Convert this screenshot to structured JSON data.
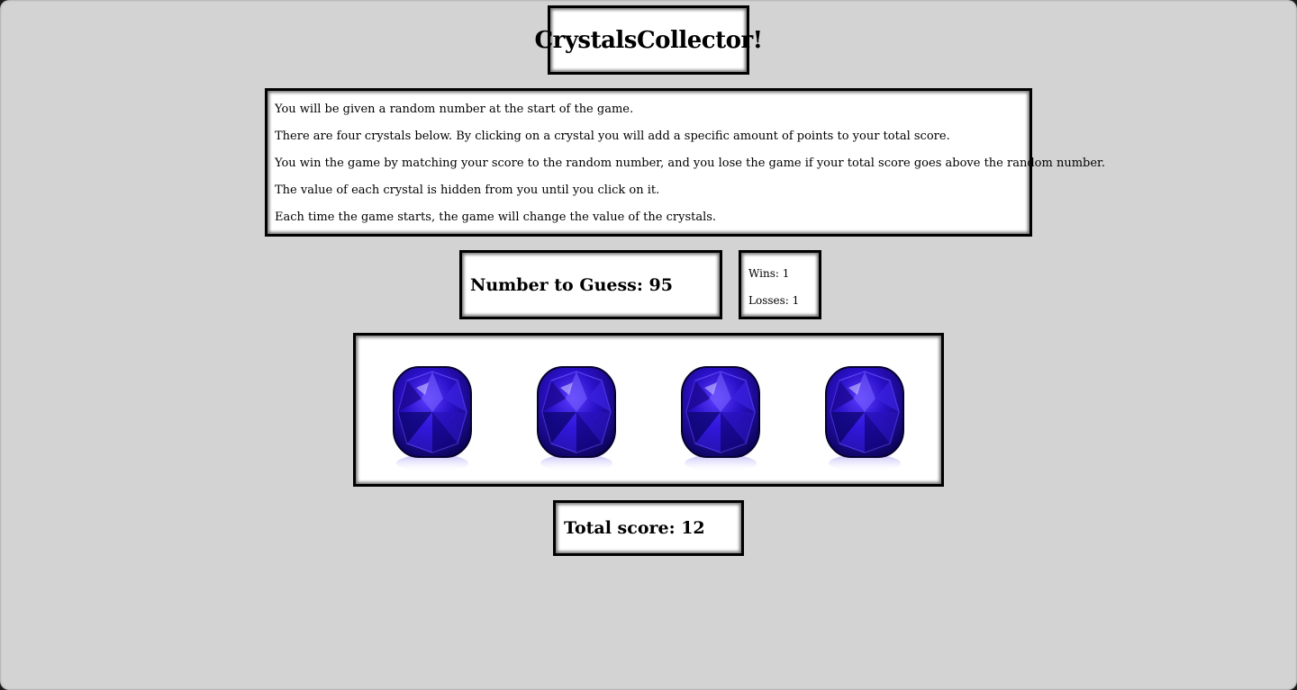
{
  "header": {
    "title": "CrystalsCollector!"
  },
  "instructions": [
    "You will be given a random number at the start of the game.",
    "There are four crystals below. By clicking on a crystal you will add a specific amount of points to your total score.",
    "You win the game by matching your score to the random number, and you lose the game if your total score goes above the random number.",
    "The value of each crystal is hidden from you until you click on it.",
    "Each time the game starts, the game will change the value of the crystals."
  ],
  "target": {
    "label": "Number to Guess: 95"
  },
  "stats": {
    "wins": "Wins: 1",
    "losses": "Losses: 1"
  },
  "crystals": [
    {
      "name": "crystal-1",
      "icon": "sapphire-gem-icon"
    },
    {
      "name": "crystal-2",
      "icon": "sapphire-gem-icon"
    },
    {
      "name": "crystal-3",
      "icon": "sapphire-gem-icon"
    },
    {
      "name": "crystal-4",
      "icon": "sapphire-gem-icon"
    }
  ],
  "score": {
    "label": "Total score: 12"
  },
  "colors": {
    "background": "#d3d3d3",
    "gem": "#2a10c8"
  }
}
